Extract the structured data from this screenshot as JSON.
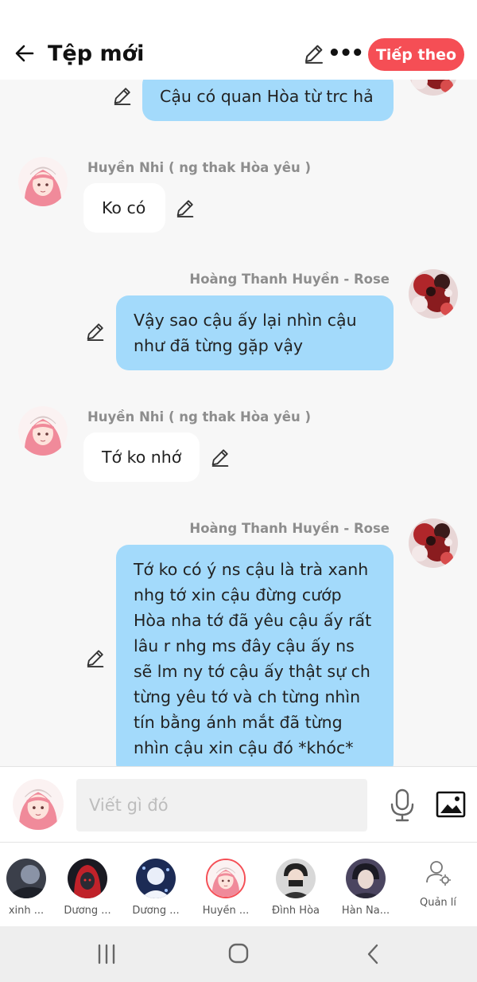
{
  "header": {
    "title": "Tệp mới",
    "next_label": "Tiếp theo",
    "more_label": "•••"
  },
  "messages": [
    {
      "side": "right",
      "sender": "",
      "text": "Cậu có quan Hòa từ trc hả",
      "avatar": "rose-avatar"
    },
    {
      "side": "left",
      "sender": "Huyền Nhi ( ng thak Hòa yêu )",
      "text": "Ko có",
      "avatar": "huyen-nhi-avatar"
    },
    {
      "side": "right",
      "sender": "Hoàng Thanh Huyền - Rose",
      "lines": [
        "Vậy sao cậu ấy lại nhìn cậu",
        "như đã từng gặp vậy"
      ],
      "avatar": "rose-avatar"
    },
    {
      "side": "left",
      "sender": "Huyền Nhi ( ng thak Hòa yêu )",
      "text": "Tớ ko nhớ",
      "avatar": "huyen-nhi-avatar"
    },
    {
      "side": "right",
      "sender": "Hoàng Thanh Huyền - Rose",
      "lines": [
        "Tớ ko có ý ns cậu là trà xanh",
        "nhg tớ xin cậu đừng cướp",
        "Hòa  nha tớ đã yêu cậu ấy rất",
        "lâu r nhg ms đây cậu ấy ns",
        "sẽ lm ny tớ cậu ấy thật sự ch",
        "từng yêu tớ và ch từng nhìn",
        "tín bằng ánh mắt đã từng",
        "nhìn cậu xin cậu đó *khóc*"
      ],
      "avatar": "rose-avatar"
    }
  ],
  "composer": {
    "placeholder": "Viết gì đó"
  },
  "members": [
    {
      "name": "xinh ...",
      "avatar": "member-avatar-1"
    },
    {
      "name": "Dương ...",
      "avatar": "member-avatar-2"
    },
    {
      "name": "Dương ...",
      "avatar": "member-avatar-3"
    },
    {
      "name": "Huyền ...",
      "avatar": "member-avatar-4"
    },
    {
      "name": "Đình Hòa",
      "avatar": "member-avatar-5"
    },
    {
      "name": "Hàn Na...",
      "avatar": "member-avatar-6"
    }
  ],
  "manage_label": "Quản lí",
  "icons": {
    "back": "arrow-left-icon",
    "edit": "pencil-icon",
    "mic": "microphone-icon",
    "image": "image-icon",
    "manage": "user-gear-icon",
    "nav_recent": "recent-apps-icon",
    "nav_home": "home-icon",
    "nav_back": "chevron-left-icon"
  },
  "colors": {
    "accent": "#f54e55",
    "bubble_blue": "#a3dafb",
    "bubble_white": "#ffffff",
    "sender_gray": "#8d8d8d"
  }
}
